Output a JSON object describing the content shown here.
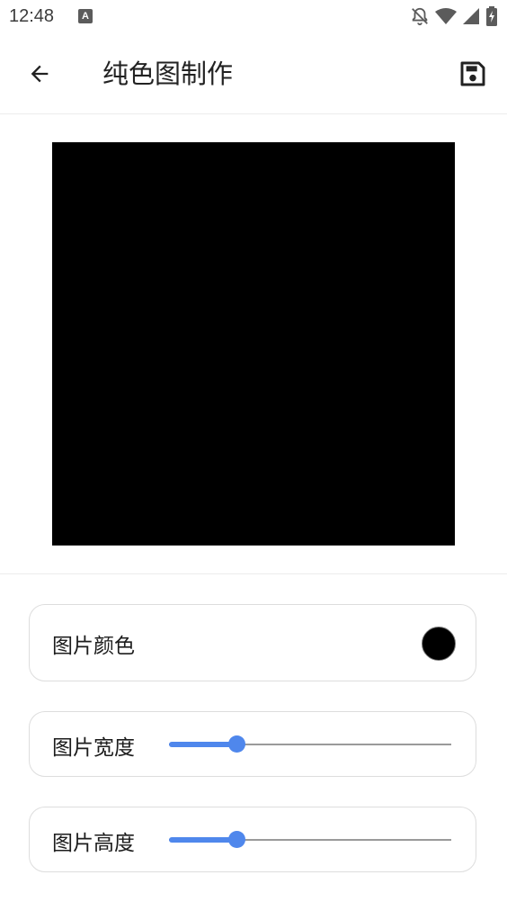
{
  "status_bar": {
    "time": "12:48",
    "notification_icon": "a-badge-icon",
    "icons": [
      "bell-off-icon",
      "wifi-icon",
      "cell-signal-icon",
      "battery-charging-icon"
    ]
  },
  "app_bar": {
    "title": "纯色图制作",
    "back_icon": "arrow-back-icon",
    "save_icon": "floppy-disk-save-icon"
  },
  "preview": {
    "fill_color": "#000000"
  },
  "settings": {
    "color_label": "图片颜色",
    "color_value": "#000000",
    "width_label": "图片宽度",
    "width_fraction": 0.24,
    "height_label": "图片高度",
    "height_fraction": 0.24
  },
  "colors": {
    "accent": "#4f87ec",
    "card_border": "#dddddd"
  }
}
